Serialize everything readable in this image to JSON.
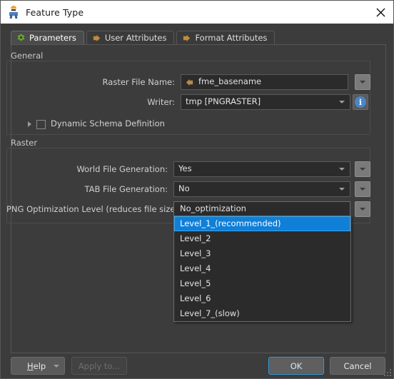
{
  "window": {
    "title": "Feature Type",
    "icon": "feature-type-icon",
    "close_icon": "close-icon"
  },
  "tabs": [
    {
      "label": "Parameters",
      "icon": "gear-icon",
      "active": true
    },
    {
      "label": "User Attributes",
      "icon": "arrow-icon",
      "active": false
    },
    {
      "label": "Format Attributes",
      "icon": "arrow-icon",
      "active": false
    }
  ],
  "general": {
    "title": "General",
    "raster_file_name": {
      "label": "Raster File Name:",
      "value": "fme_basename",
      "token_icon": "attribute-arrow-icon",
      "dropdown_icon": "chevron-down-icon"
    },
    "writer": {
      "label": "Writer:",
      "value": "tmp [PNGRASTER]",
      "dropdown_icon": "chevron-down-icon",
      "info_icon": "info-icon",
      "info_glyph": "i"
    },
    "dynamic_schema": {
      "label": "Dynamic Schema Definition",
      "checked": false,
      "expander_icon": "chevron-right-icon"
    }
  },
  "raster": {
    "title": "Raster",
    "rows": [
      {
        "label": "World File Generation:",
        "value": "Yes",
        "dropdown_icon": "chevron-down-icon"
      },
      {
        "label": "TAB File Generation:",
        "value": "No",
        "dropdown_icon": "chevron-down-icon"
      },
      {
        "label": "PNG Optimization Level (reduces file size):",
        "value": "No_optimization",
        "dropdown_icon": "chevron-down-icon"
      }
    ]
  },
  "png_options_popup": {
    "open": true,
    "items": [
      {
        "label": "No_optimization",
        "selected": false
      },
      {
        "label": "Level_1_(recommended)",
        "selected": true
      },
      {
        "label": "Level_2",
        "selected": false
      },
      {
        "label": "Level_3",
        "selected": false
      },
      {
        "label": "Level_4",
        "selected": false
      },
      {
        "label": "Level_5",
        "selected": false
      },
      {
        "label": "Level_6",
        "selected": false
      },
      {
        "label": "Level_7_(slow)",
        "selected": false
      }
    ]
  },
  "footer": {
    "help": {
      "accel": "H",
      "rest": "elp",
      "dropdown_icon": "chevron-down-icon"
    },
    "apply_to": "Apply to...",
    "ok": "OK",
    "cancel": "Cancel"
  },
  "colors": {
    "window_bg": "#3c3c3c",
    "titlebar_bg": "#ffffff",
    "field_bg": "#2b2b2b",
    "highlight": "#0f7fd8",
    "accent_blue": "#4a86c8",
    "tab_icon_green": "#5a9e2f",
    "tab_icon_orange": "#c08b37"
  }
}
